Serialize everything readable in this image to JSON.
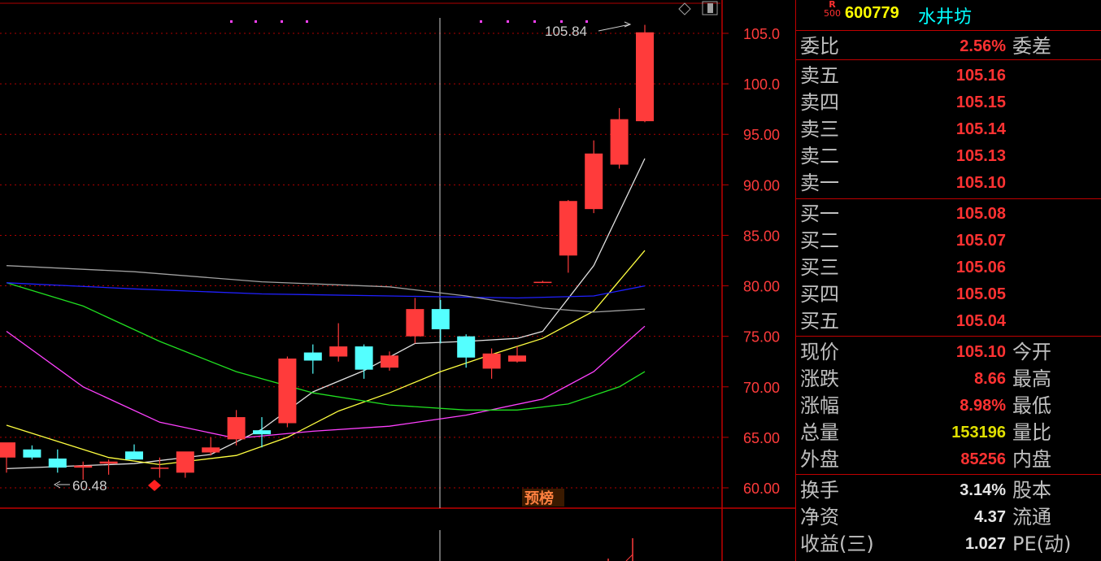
{
  "stock": {
    "r_tag": "R",
    "r_num": "500",
    "code": "600779",
    "name": "水井坊"
  },
  "axis_labels": [
    "105.0",
    "100.0",
    "95.00",
    "90.00",
    "85.00",
    "80.00",
    "75.00",
    "70.00",
    "65.00",
    "60.00"
  ],
  "high_label": "105.84",
  "low_label": "60.48",
  "badge": "预榜",
  "weibi": {
    "label": "委比",
    "value": "2.56%",
    "label2": "委差"
  },
  "sells": [
    {
      "label": "卖五",
      "value": "105.16"
    },
    {
      "label": "卖四",
      "value": "105.15"
    },
    {
      "label": "卖三",
      "value": "105.14"
    },
    {
      "label": "卖二",
      "value": "105.13"
    },
    {
      "label": "卖一",
      "value": "105.10"
    }
  ],
  "buys": [
    {
      "label": "买一",
      "value": "105.08"
    },
    {
      "label": "买二",
      "value": "105.07"
    },
    {
      "label": "买三",
      "value": "105.06"
    },
    {
      "label": "买四",
      "value": "105.05"
    },
    {
      "label": "买五",
      "value": "105.04"
    }
  ],
  "quote": [
    {
      "label": "现价",
      "value": "105.10",
      "label2": "今开",
      "color": "red"
    },
    {
      "label": "涨跌",
      "value": "8.66",
      "label2": "最高",
      "color": "red"
    },
    {
      "label": "涨幅",
      "value": "8.98%",
      "label2": "最低",
      "color": "red"
    },
    {
      "label": "总量",
      "value": "153196",
      "label2": "量比",
      "color": "yel"
    },
    {
      "label": "外盘",
      "value": "85256",
      "label2": "内盘",
      "color": "red"
    }
  ],
  "fund": [
    {
      "label": "换手",
      "value": "3.14%",
      "label2": "股本"
    },
    {
      "label": "净资",
      "value": "4.37",
      "label2": "流通"
    },
    {
      "label": "收益(三)",
      "value": "1.027",
      "label2": "PE(动)"
    }
  ],
  "colors": {
    "up": "#ff3b3b",
    "down": "#54ffff",
    "grid": "#b00000",
    "ma5": "#e0e0e0",
    "ma10": "#ffff40",
    "ma20": "#ff40ff",
    "ma60": "#20e020",
    "ma120": "#2020ff",
    "ma250": "#a0a0a0"
  },
  "chart_data": {
    "type": "candlestick",
    "ylim": [
      58.5,
      107
    ],
    "candles": [
      {
        "o": 63.0,
        "h": 64.0,
        "l": 61.5,
        "c": 64.5
      },
      {
        "o": 63.8,
        "h": 64.2,
        "l": 62.8,
        "c": 63.0
      },
      {
        "o": 62.9,
        "h": 63.8,
        "l": 61.5,
        "c": 62.0
      },
      {
        "o": 62.0,
        "h": 62.6,
        "l": 60.8,
        "c": 62.2
      },
      {
        "o": 62.4,
        "h": 62.8,
        "l": 61.3,
        "c": 62.6
      },
      {
        "o": 63.6,
        "h": 64.3,
        "l": 63.0,
        "c": 62.8
      },
      {
        "o": 61.9,
        "h": 63.0,
        "l": 61.0,
        "c": 62.0
      },
      {
        "o": 61.5,
        "h": 63.5,
        "l": 61.0,
        "c": 63.6
      },
      {
        "o": 63.5,
        "h": 65.0,
        "l": 63.2,
        "c": 64.0
      },
      {
        "o": 64.8,
        "h": 67.7,
        "l": 64.2,
        "c": 67.0
      },
      {
        "o": 65.7,
        "h": 67.0,
        "l": 64.0,
        "c": 65.3
      },
      {
        "o": 66.4,
        "h": 73.0,
        "l": 66.0,
        "c": 72.8
      },
      {
        "o": 73.4,
        "h": 74.2,
        "l": 71.3,
        "c": 72.6
      },
      {
        "o": 73.0,
        "h": 76.3,
        "l": 72.5,
        "c": 74.0
      },
      {
        "o": 74.0,
        "h": 74.2,
        "l": 70.8,
        "c": 71.7
      },
      {
        "o": 71.9,
        "h": 73.5,
        "l": 71.6,
        "c": 73.1
      },
      {
        "o": 75.0,
        "h": 78.8,
        "l": 74.3,
        "c": 77.7
      },
      {
        "o": 77.7,
        "h": 78.6,
        "l": 74.3,
        "c": 75.7
      },
      {
        "o": 75.0,
        "h": 75.2,
        "l": 71.9,
        "c": 72.9
      },
      {
        "o": 71.8,
        "h": 73.8,
        "l": 70.8,
        "c": 73.3
      },
      {
        "o": 72.5,
        "h": 74.0,
        "l": 72.4,
        "c": 73.1
      },
      {
        "o": 80.4,
        "h": 80.5,
        "l": 80.3,
        "c": 80.4
      },
      {
        "o": 83.0,
        "h": 88.5,
        "l": 81.3,
        "c": 88.4
      },
      {
        "o": 87.6,
        "h": 94.4,
        "l": 87.2,
        "c": 93.1
      },
      {
        "o": 92.0,
        "h": 97.6,
        "l": 91.6,
        "c": 96.5
      },
      {
        "o": 96.3,
        "h": 105.84,
        "l": 96.2,
        "c": 105.1
      }
    ],
    "ma": [
      {
        "name": "ma5",
        "pts": [
          [
            0,
            61.9
          ],
          [
            5,
            62.4
          ],
          [
            8,
            63.3
          ],
          [
            10,
            65.8
          ],
          [
            12,
            69.5
          ],
          [
            14,
            71.6
          ],
          [
            16,
            74.3
          ],
          [
            18,
            74.5
          ],
          [
            20,
            74.8
          ],
          [
            21,
            75.5
          ],
          [
            23,
            82.0
          ],
          [
            25,
            92.6
          ]
        ]
      },
      {
        "name": "ma10",
        "pts": [
          [
            0,
            66.2
          ],
          [
            4,
            63.0
          ],
          [
            6,
            62.3
          ],
          [
            9,
            63.2
          ],
          [
            11,
            65.0
          ],
          [
            13,
            67.6
          ],
          [
            15,
            69.4
          ],
          [
            17,
            71.5
          ],
          [
            19,
            73.2
          ],
          [
            21,
            74.8
          ],
          [
            23,
            77.5
          ],
          [
            25,
            83.5
          ]
        ]
      },
      {
        "name": "ma20",
        "pts": [
          [
            0,
            75.5
          ],
          [
            3,
            70.0
          ],
          [
            6,
            66.5
          ],
          [
            9,
            64.9
          ],
          [
            12,
            65.6
          ],
          [
            15,
            66.1
          ],
          [
            18,
            67.2
          ],
          [
            21,
            68.8
          ],
          [
            23,
            71.5
          ],
          [
            25,
            76.0
          ]
        ]
      },
      {
        "name": "ma60",
        "pts": [
          [
            0,
            80.3
          ],
          [
            3,
            78.0
          ],
          [
            6,
            74.5
          ],
          [
            9,
            71.5
          ],
          [
            12,
            69.4
          ],
          [
            15,
            68.2
          ],
          [
            18,
            67.7
          ],
          [
            20,
            67.7
          ],
          [
            22,
            68.3
          ],
          [
            24,
            70.0
          ],
          [
            25,
            71.5
          ]
        ]
      },
      {
        "name": "ma120",
        "pts": [
          [
            0,
            80.3
          ],
          [
            5,
            79.7
          ],
          [
            10,
            79.2
          ],
          [
            15,
            79.0
          ],
          [
            20,
            78.8
          ],
          [
            23,
            79.0
          ],
          [
            25,
            80.0
          ]
        ]
      },
      {
        "name": "ma250",
        "pts": [
          [
            0,
            82.0
          ],
          [
            5,
            81.4
          ],
          [
            10,
            80.4
          ],
          [
            15,
            79.9
          ],
          [
            18,
            79.0
          ],
          [
            21,
            77.8
          ],
          [
            23,
            77.4
          ],
          [
            25,
            77.7
          ]
        ]
      }
    ]
  }
}
